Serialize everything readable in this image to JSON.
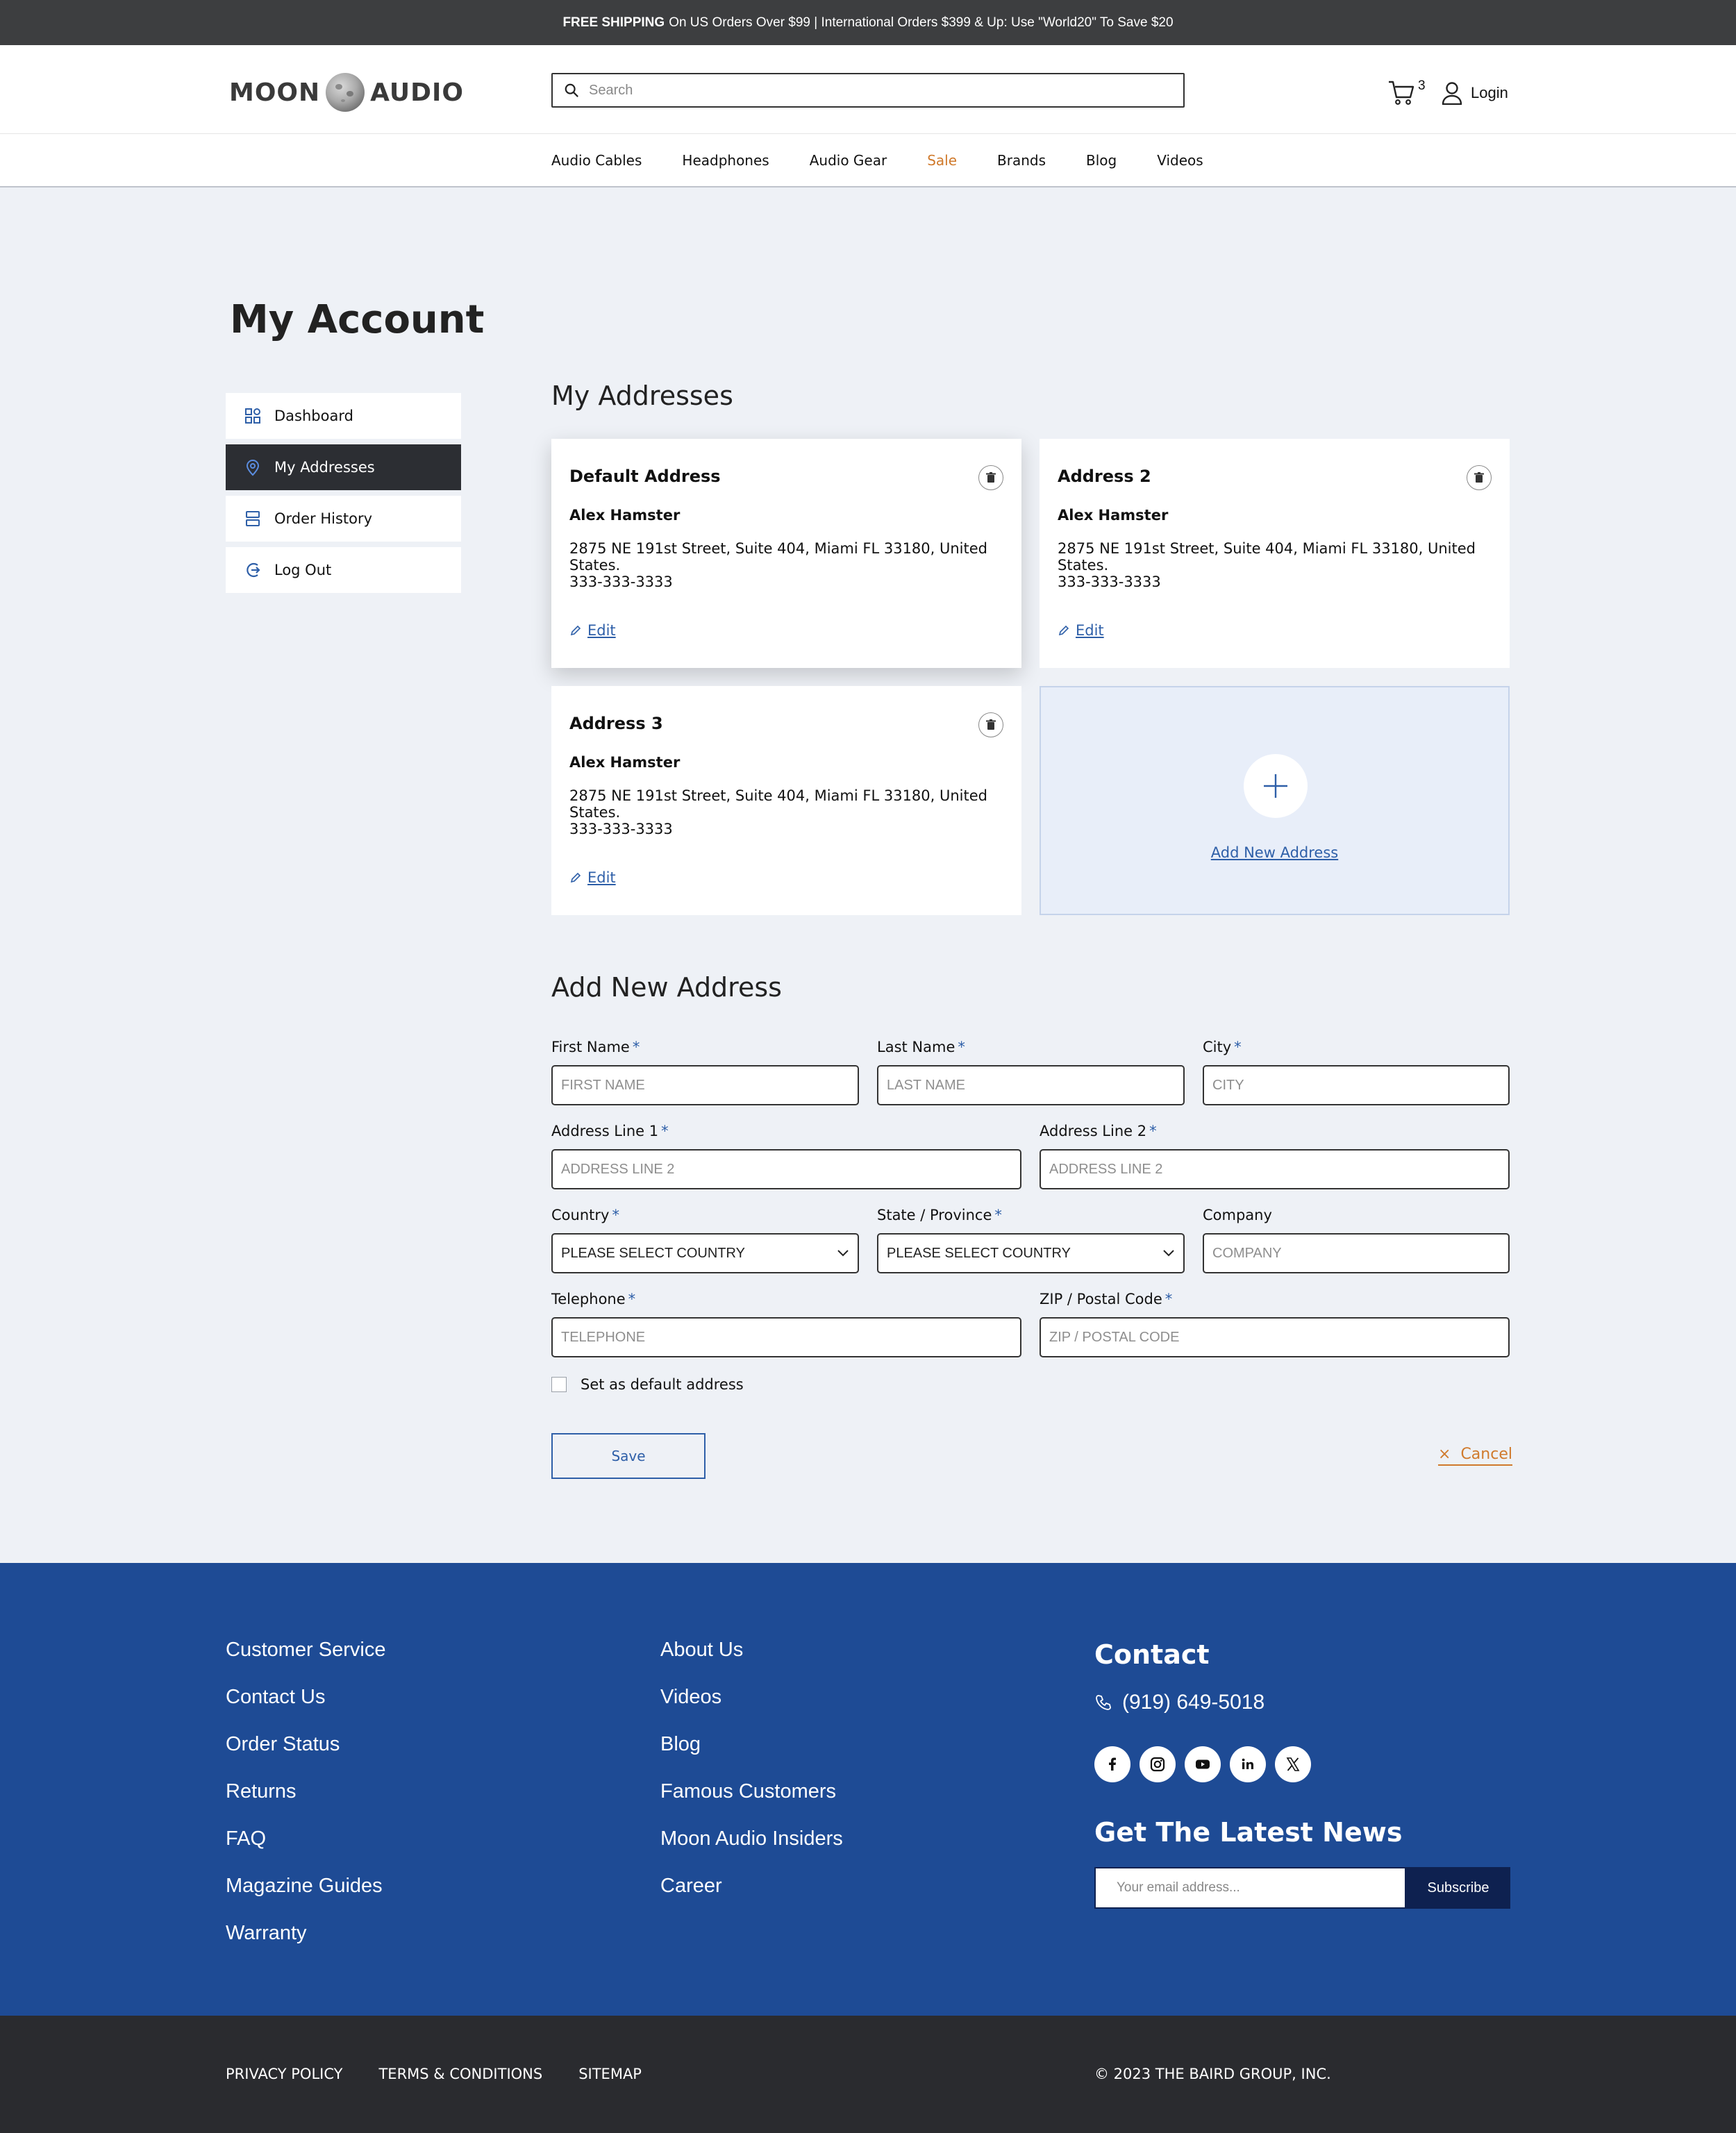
{
  "promo": {
    "bold": "FREE SHIPPING",
    "text": "On US Orders Over $99 | International Orders $399 & Up: Use \"World20\" To Save $20"
  },
  "header": {
    "logo_left": "MOON",
    "logo_right": "AUDIO",
    "search_placeholder": "Search",
    "cart_count": "3",
    "login_label": "Login"
  },
  "nav": {
    "items": [
      "Audio Cables",
      "Headphones",
      "Audio Gear",
      "Sale",
      "Brands",
      "Blog",
      "Videos"
    ]
  },
  "page_title": "My Account",
  "sidebar": {
    "items": [
      {
        "label": "Dashboard",
        "icon": "dashboard-icon"
      },
      {
        "label": "My Addresses",
        "icon": "location-pin-icon"
      },
      {
        "label": "Order History",
        "icon": "order-history-icon"
      },
      {
        "label": "Log Out",
        "icon": "logout-icon"
      }
    ]
  },
  "addresses": {
    "title": "My Addresses",
    "edit_label": "Edit",
    "cards": [
      {
        "title": "Default Address",
        "name": "Alex Hamster",
        "address": "2875 NE 191st Street, Suite 404, Miami FL 33180, United States.",
        "phone": "333-333-3333"
      },
      {
        "title": "Address 2",
        "name": "Alex Hamster",
        "address": "2875 NE 191st Street, Suite 404, Miami FL 33180, United States.",
        "phone": "333-333-3333"
      },
      {
        "title": "Address 3",
        "name": "Alex Hamster",
        "address": "2875 NE 191st Street, Suite 404, Miami FL 33180, United States.",
        "phone": "333-333-3333"
      }
    ],
    "add_label": "Add New Address"
  },
  "form": {
    "title": "Add New Address",
    "required_mark": "*",
    "first_name": {
      "label": "First Name",
      "placeholder": "FIRST NAME"
    },
    "last_name": {
      "label": "Last Name",
      "placeholder": "LAST NAME"
    },
    "city": {
      "label": "City",
      "placeholder": "CITY"
    },
    "address1": {
      "label": "Address Line 1",
      "placeholder": "ADDRESS LINE 2"
    },
    "address2": {
      "label": "Address Line 2",
      "placeholder": "ADDRESS LINE 2"
    },
    "country": {
      "label": "Country",
      "value": "PLEASE SELECT COUNTRY"
    },
    "state": {
      "label": "State / Province",
      "value": "PLEASE SELECT COUNTRY"
    },
    "company": {
      "label": "Company",
      "placeholder": "COMPANY"
    },
    "telephone": {
      "label": "Telephone",
      "placeholder": "TELEPHONE"
    },
    "zip": {
      "label": "ZIP / Postal Code",
      "placeholder": "ZIP / POSTAL CODE"
    },
    "default_label": "Set as default address",
    "save_label": "Save",
    "cancel_label": "Cancel",
    "cancel_mark": "×"
  },
  "footer": {
    "col1": [
      "Customer Service",
      "Contact Us",
      "Order Status",
      "Returns",
      "FAQ",
      "Magazine Guides",
      "Warranty"
    ],
    "col2": [
      "About Us",
      "Videos",
      "Blog",
      "Famous Customers",
      "Moon Audio Insiders",
      "Career"
    ],
    "contact_title": "Contact",
    "phone": "(919) 649-5018",
    "social_icons": [
      "facebook-icon",
      "instagram-icon",
      "youtube-icon",
      "linkedin-icon",
      "x-icon"
    ],
    "news_title": "Get The Latest News",
    "email_placeholder": "Your email address...",
    "subscribe_label": "Subscribe"
  },
  "bottom": {
    "links": [
      "PRIVACY POLICY",
      "TERMS & CONDITIONS",
      "SITEMAP"
    ],
    "copyright": "© 2023 THE BAIRD GROUP, INC."
  },
  "colors": {
    "accent": "#2e5fa8",
    "sale": "#d07a2c",
    "footer": "#1e4b95",
    "bottom": "#2a2b2f",
    "promo": "#3d3e40"
  }
}
